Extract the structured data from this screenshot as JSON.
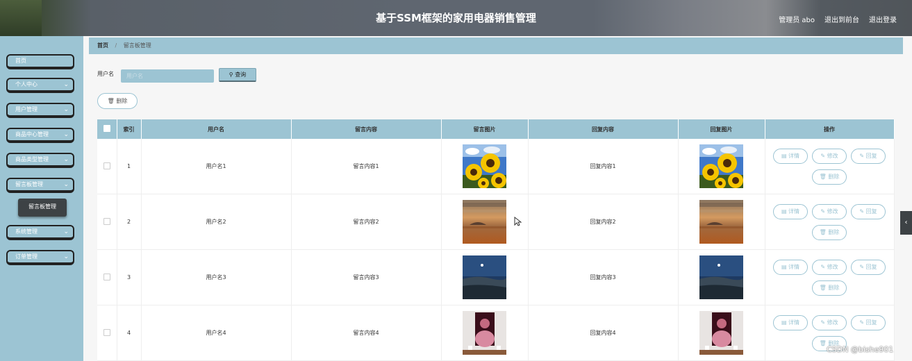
{
  "header": {
    "title": "基于SSM框架的家用电器销售管理",
    "admin_label": "管理员 abo",
    "front_link": "退出到前台",
    "logout_link": "退出登录"
  },
  "sidebar": {
    "items": [
      {
        "label": "首页",
        "has_children": false
      },
      {
        "label": "个人中心",
        "has_children": true
      },
      {
        "label": "用户管理",
        "has_children": true
      },
      {
        "label": "商品中心管理",
        "has_children": true
      },
      {
        "label": "商品类型管理",
        "has_children": true
      },
      {
        "label": "留言板管理",
        "has_children": true
      },
      {
        "label": "系统管理",
        "has_children": true
      },
      {
        "label": "订单管理",
        "has_children": true
      }
    ],
    "submenu_active": "留言板管理"
  },
  "breadcrumb": {
    "home": "首页",
    "separator": "/",
    "current": "留言板管理"
  },
  "search": {
    "label": "用户名",
    "placeholder": "用户名",
    "button": "查询"
  },
  "toolbar": {
    "delete_label": "删除"
  },
  "table": {
    "headers": [
      "索引",
      "用户名",
      "留言内容",
      "留言图片",
      "回复内容",
      "回复图片",
      "操作"
    ],
    "rows": [
      {
        "index": "1",
        "user": "用户名1",
        "content": "留言内容1",
        "image": "sunflower",
        "reply": "回复内容1",
        "reply_image": "sunflower"
      },
      {
        "index": "2",
        "user": "用户名2",
        "content": "留言内容2",
        "image": "desert",
        "reply": "回复内容2",
        "reply_image": "desert"
      },
      {
        "index": "3",
        "user": "用户名3",
        "content": "留言内容3",
        "image": "night",
        "reply": "回复内容3",
        "reply_image": "night"
      },
      {
        "index": "4",
        "user": "用户名4",
        "content": "留言内容4",
        "image": "portrait",
        "reply": "回复内容4",
        "reply_image": "portrait"
      }
    ],
    "actions": {
      "detail": "详情",
      "edit": "修改",
      "reply": "回复",
      "delete": "删除"
    }
  },
  "watermark": "CSDN @bishe901",
  "colors": {
    "accent": "#9cc4d3",
    "header_dark": "#5f6670",
    "menu_border": "#222222"
  },
  "icons": {
    "search": "search-icon",
    "delete": "trash-icon",
    "detail": "document-icon",
    "edit": "pencil-icon",
    "reply": "pencil-icon",
    "chevron": "chevron-down-icon",
    "collapse": "chevron-left-icon"
  }
}
